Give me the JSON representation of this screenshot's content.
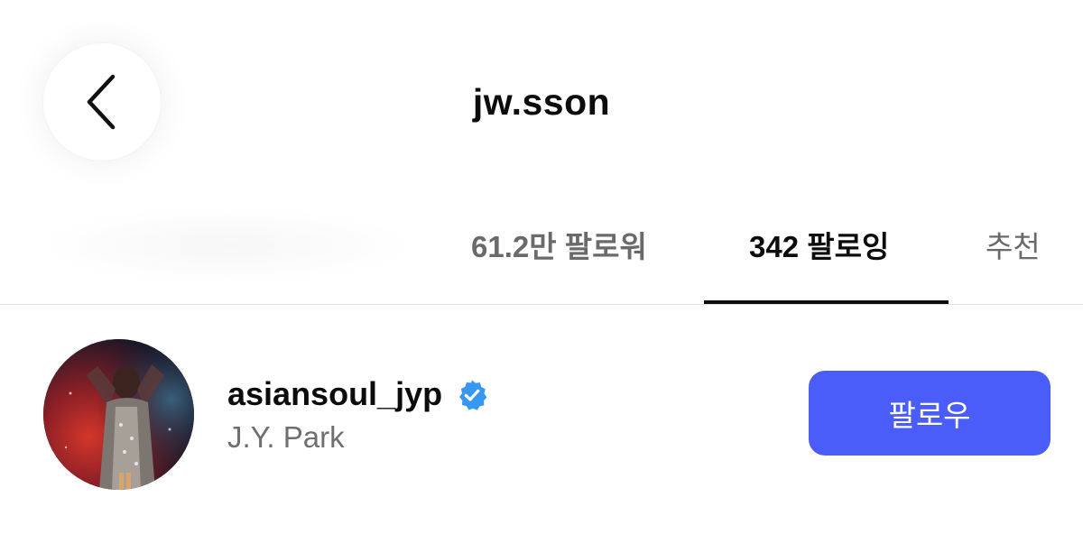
{
  "header": {
    "title": "jw.sson",
    "back_icon": "chevron-left-icon"
  },
  "tabs": [
    {
      "label": "61.2만 팔로워",
      "active": false
    },
    {
      "label": "342 팔로잉",
      "active": true
    },
    {
      "label": "추천",
      "active": false
    }
  ],
  "list": [
    {
      "username": "asiansoul_jyp",
      "verified": true,
      "full_name": "J.Y. Park",
      "follow_label": "팔로우"
    }
  ],
  "colors": {
    "accent": "#4a5df9",
    "verified": "#3897f0",
    "text_primary": "#0c0c0c",
    "text_secondary": "#6f6f6f"
  }
}
